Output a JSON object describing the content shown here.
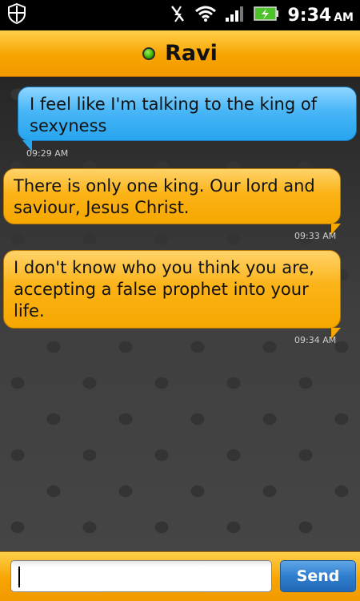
{
  "status_bar": {
    "time": "9:34",
    "ampm": "AM",
    "icons": [
      "shield-icon",
      "no-signal-icon",
      "wifi-icon",
      "signal-bars-icon",
      "battery-charging-icon"
    ]
  },
  "header": {
    "contact_name": "Ravi",
    "status": "online",
    "status_color": "#38b000"
  },
  "messages": [
    {
      "direction": "sent",
      "text": "I feel like I'm talking to the king of sexyness",
      "time": "09:29 AM"
    },
    {
      "direction": "received",
      "text": "There is only one king. Our lord and saviour, Jesus Christ.",
      "time": "09:33 AM"
    },
    {
      "direction": "received",
      "text": "I don't know who you think you are, accepting a false prophet into your life.",
      "time": "09:34 AM"
    }
  ],
  "composer": {
    "input_value": "",
    "send_label": "Send"
  },
  "colors": {
    "sent_bubble": "#27a5ef",
    "received_bubble": "#f6a700",
    "title_bar": "#f7a400",
    "send_button": "#2f7fcf"
  }
}
